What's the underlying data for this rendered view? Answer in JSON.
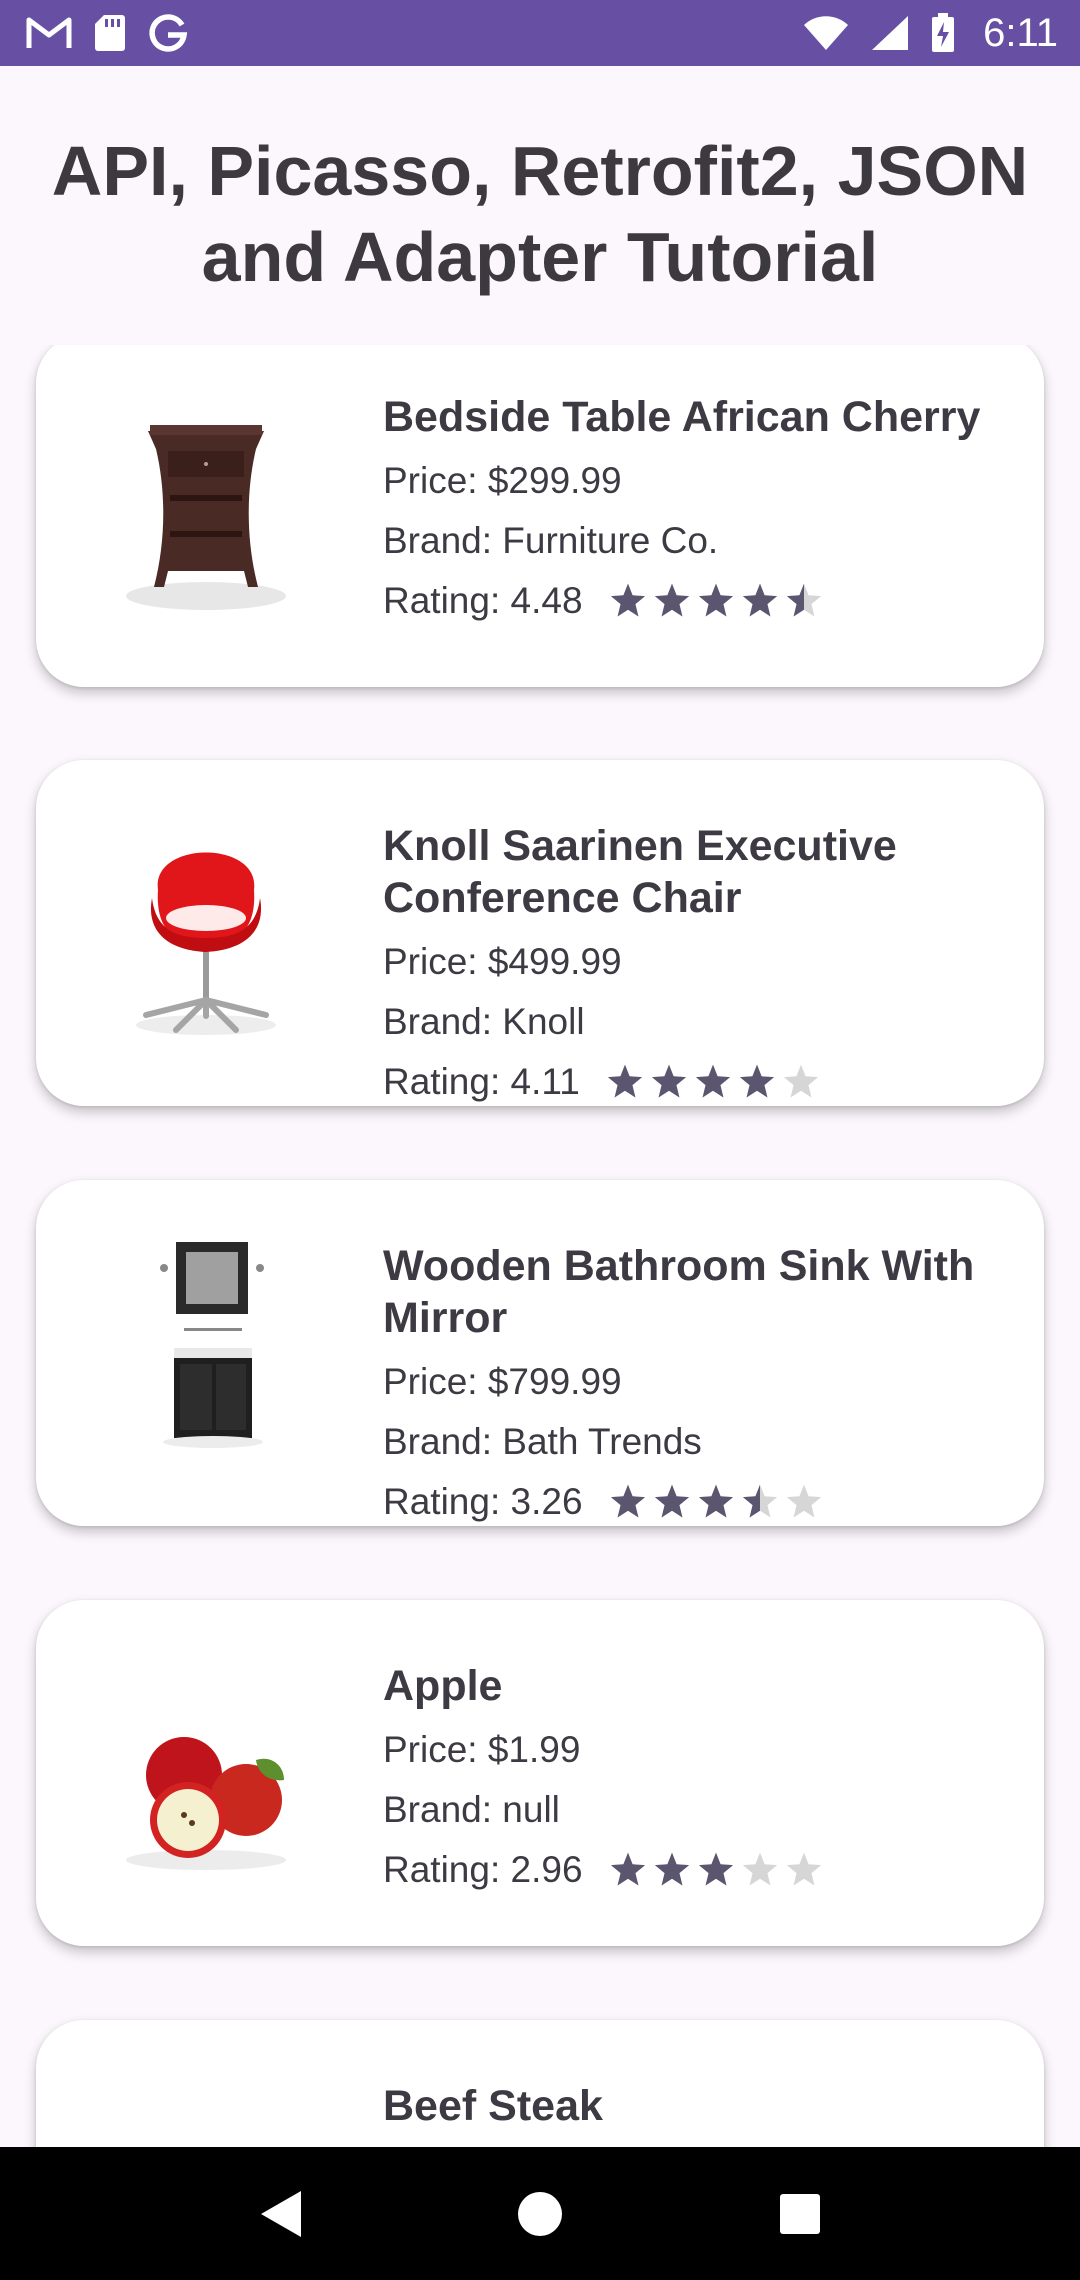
{
  "status_bar": {
    "time": "6:11",
    "left_icons": [
      "gmail-icon",
      "sd-card-icon",
      "google-icon"
    ],
    "right_icons": [
      "wifi-icon",
      "signal-icon",
      "battery-charging-icon"
    ]
  },
  "page_title": "API, Picasso, Retrofit2, JSON and Adapter Tutorial",
  "colors": {
    "primary": "#6750a4",
    "background": "#fcf7fd",
    "star_filled": "#5b5570",
    "star_empty": "#d6d6d6"
  },
  "products": [
    {
      "name": "Bedside Table African Cherry",
      "price_text": "Price: $299.99",
      "brand_text": "Brand: Furniture Co.",
      "rating_text": "Rating: 4.48",
      "rating": 4.48,
      "image_icon": "bedside-table-image"
    },
    {
      "name": "Knoll Saarinen Executive Conference Chair",
      "price_text": "Price: $499.99",
      "brand_text": "Brand: Knoll",
      "rating_text": "Rating: 4.11",
      "rating": 4.11,
      "image_icon": "office-chair-image"
    },
    {
      "name": "Wooden Bathroom Sink With Mirror",
      "price_text": "Price: $799.99",
      "brand_text": "Brand: Bath Trends",
      "rating_text": "Rating: 3.26",
      "rating": 3.26,
      "image_icon": "bathroom-sink-image"
    },
    {
      "name": "Apple",
      "price_text": "Price: $1.99",
      "brand_text": "Brand: null",
      "rating_text": "Rating: 2.96",
      "rating": 2.96,
      "image_icon": "apple-image"
    },
    {
      "name": "Beef Steak",
      "image_icon": "beef-steak-image"
    }
  ],
  "nav_bar": {
    "buttons": [
      "back-icon",
      "home-icon",
      "recents-icon"
    ]
  }
}
